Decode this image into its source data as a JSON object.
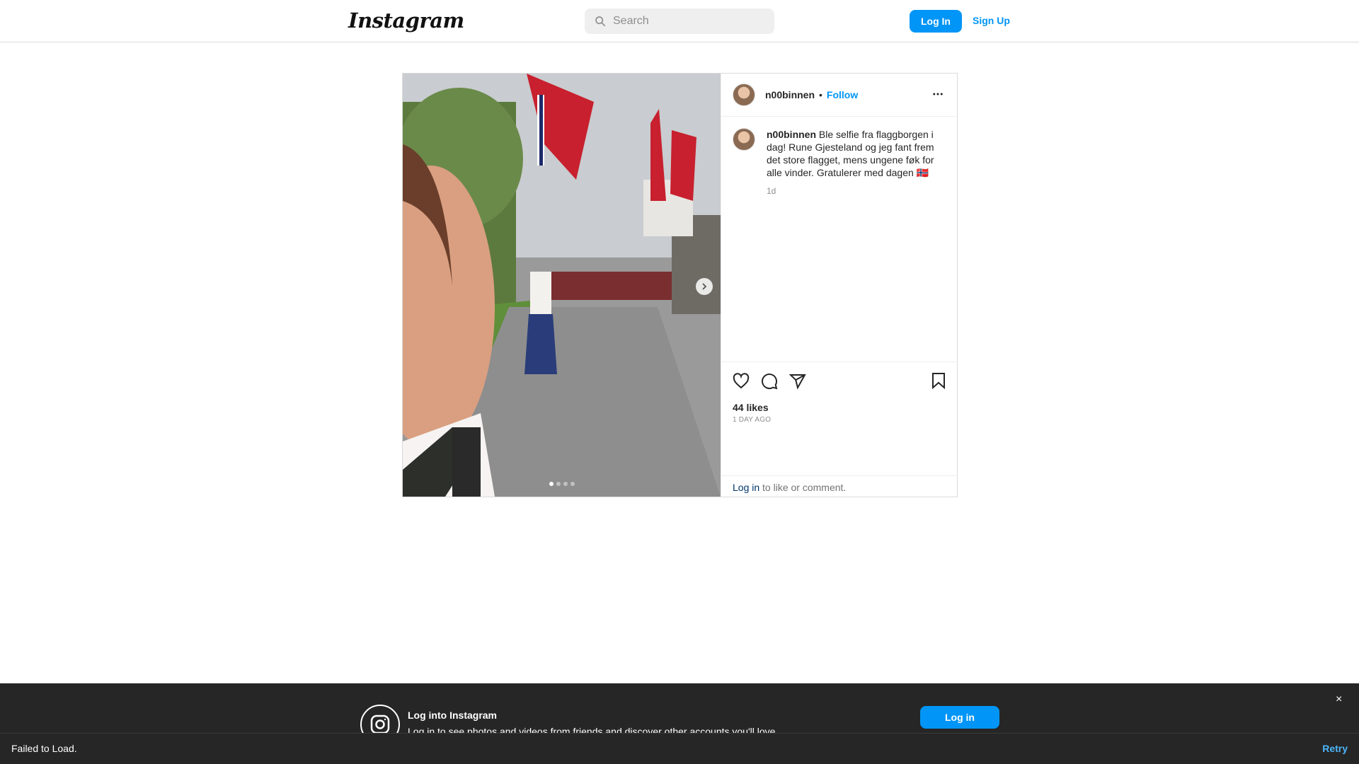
{
  "nav": {
    "logo_text": "Instagram",
    "search_placeholder": "Search",
    "login_label": "Log In",
    "signup_label": "Sign Up"
  },
  "post": {
    "username": "n00binnen",
    "bullet": "•",
    "follow_label": "Follow",
    "caption_username": "n00binnen",
    "caption_text": "Ble selfie fra flaggborgen i dag! Rune Gjesteland og jeg fant frem det store flagget, mens ungene føk for alle vinder. Gratulerer med dagen 🇳🇴",
    "caption_time": "1d",
    "likes": "44 likes",
    "timestamp": "1 DAY AGO",
    "comment_login": "Log in",
    "comment_rest": " to like or comment.",
    "carousel_count": 4,
    "carousel_active": 1
  },
  "banner": {
    "title": "Log into Instagram",
    "subtitle": "Log in to see photos and videos from friends and discover other accounts you'll love.",
    "login_label": "Log in",
    "close_glyph": "×"
  },
  "toast": {
    "message": "Failed to Load.",
    "retry_label": "Retry"
  },
  "colors": {
    "accent": "#0095f6",
    "banner_bg": "#262626"
  },
  "icons": [
    "search-icon",
    "more-icon",
    "heart-icon",
    "comment-icon",
    "share-icon",
    "bookmark-icon",
    "chevron-right-icon",
    "instagram-icon",
    "close-icon"
  ]
}
